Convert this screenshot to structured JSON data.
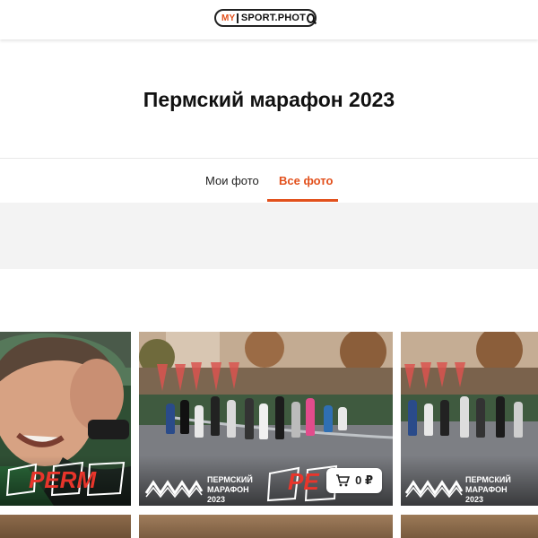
{
  "header": {
    "logo_my": "MY",
    "logo_text": "SPORT.PHOT"
  },
  "event": {
    "title": "Пермский марафон 2023"
  },
  "tabs": [
    {
      "label": "Мои фото",
      "active": false
    },
    {
      "label": "Все фото",
      "active": true
    }
  ],
  "photos": [
    {
      "watermark": "PERM"
    },
    {
      "watermark": "PE",
      "logo_line1": "ПЕРМСКИЙ",
      "logo_line2": "МАРАФОН",
      "logo_line3": "2023",
      "price": "0 ₽",
      "cart_icon": "cart-icon"
    },
    {
      "logo_line1": "ПЕРМСКИЙ",
      "logo_line2": "МАРАФОН",
      "logo_line3": "2023"
    }
  ],
  "colors": {
    "accent": "#e2501c",
    "watermark_red": "#e8352b"
  }
}
